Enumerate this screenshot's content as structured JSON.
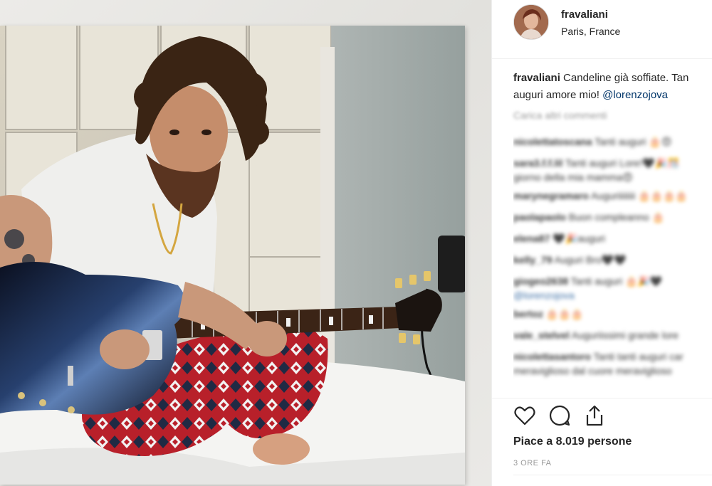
{
  "post": {
    "username": "fravaliani",
    "location": "Paris, France",
    "caption": {
      "user": "fravaliani",
      "text_line1": "Candeline già soffiate. Tan",
      "text_line2": "auguri amore mio! ",
      "mention": "@lorenzojova"
    },
    "load_more_label": "Carica altri commenti",
    "comments": [
      {
        "user": "nicolettatoscana",
        "text": "Tanti auguri 🎂😍"
      },
      {
        "user": "sara3.f.f.lil",
        "text": "Tanti auguri Lore!🖤🎉🎊",
        "cont": "giorno della mia mamma😍"
      },
      {
        "user": "marynegramaro",
        "text": "Auguriiiiiiii 🎂🎂🎂🎂"
      },
      {
        "user": "paolapaolo",
        "text": "Buon compleanno 🎂"
      },
      {
        "user": "elena87",
        "text": "🖤🎉auguri"
      },
      {
        "user": "kelly_79",
        "text": "Auguri Bro🖤🖤"
      },
      {
        "user": "giogeo2638",
        "text": "Tanti auguri 🎂🎉🖤",
        "cont_mention": "@lorenzojova"
      },
      {
        "user": "bertoz",
        "text": "🎂🎂🎂"
      },
      {
        "user": "vale_stelvel",
        "text": "Auguriissimi grande lore"
      },
      {
        "user": "nicolettasantoro",
        "text": "Tanti tanti auguri car",
        "cont": "meraviglioso dal cuore meraviglioso"
      }
    ],
    "likes_text": "Piace a 8.019 persone",
    "time_text": "3 ORE FA",
    "icons": [
      "heart-icon",
      "comment-icon",
      "share-icon"
    ]
  }
}
